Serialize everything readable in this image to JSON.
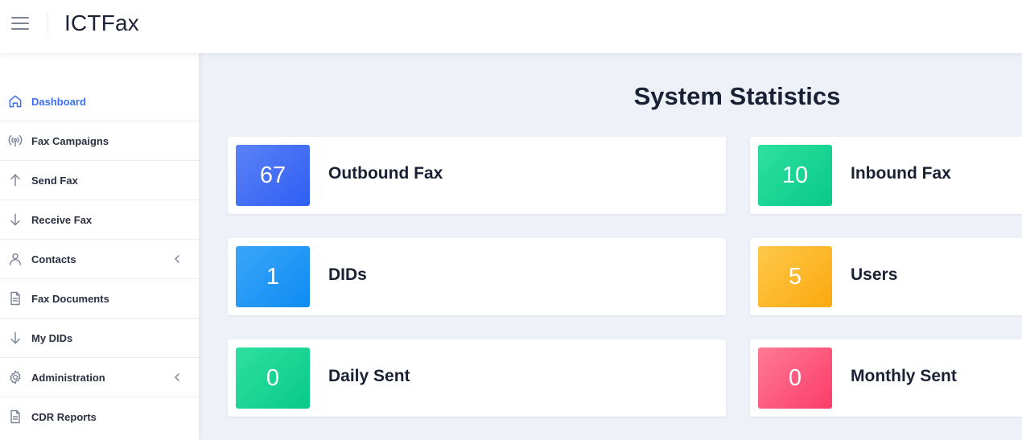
{
  "header": {
    "app_title": "ICTFax"
  },
  "sidebar": {
    "items": [
      {
        "label": "Dashboard",
        "icon": "home-icon",
        "active": true,
        "has_submenu": false
      },
      {
        "label": "Fax Campaigns",
        "icon": "broadcast-icon",
        "active": false,
        "has_submenu": false
      },
      {
        "label": "Send Fax",
        "icon": "arrow-up-icon",
        "active": false,
        "has_submenu": false
      },
      {
        "label": "Receive Fax",
        "icon": "arrow-down-icon",
        "active": false,
        "has_submenu": false
      },
      {
        "label": "Contacts",
        "icon": "user-icon",
        "active": false,
        "has_submenu": true
      },
      {
        "label": "Fax Documents",
        "icon": "document-icon",
        "active": false,
        "has_submenu": false
      },
      {
        "label": "My DIDs",
        "icon": "arrow-down-icon",
        "active": false,
        "has_submenu": false
      },
      {
        "label": "Administration",
        "icon": "gear-icon",
        "active": false,
        "has_submenu": true
      },
      {
        "label": "CDR Reports",
        "icon": "document-icon",
        "active": false,
        "has_submenu": false
      }
    ]
  },
  "main": {
    "title": "System Statistics",
    "stats": [
      {
        "value": "67",
        "label": "Outbound Fax",
        "color": "#3b6ff5"
      },
      {
        "value": "10",
        "label": "Inbound Fax",
        "color": "#12d191"
      },
      {
        "value": "1",
        "label": "DIDs",
        "color": "#1896f5"
      },
      {
        "value": "5",
        "label": "Users",
        "color": "#fcb62a"
      },
      {
        "value": "0",
        "label": "Daily Sent",
        "color": "#12d191"
      },
      {
        "value": "0",
        "label": "Monthly Sent",
        "color": "#fc5a7d"
      }
    ]
  },
  "colors": {
    "accent": "#3b6ff5",
    "background": "#eef1f8",
    "text": "#1a2135"
  }
}
